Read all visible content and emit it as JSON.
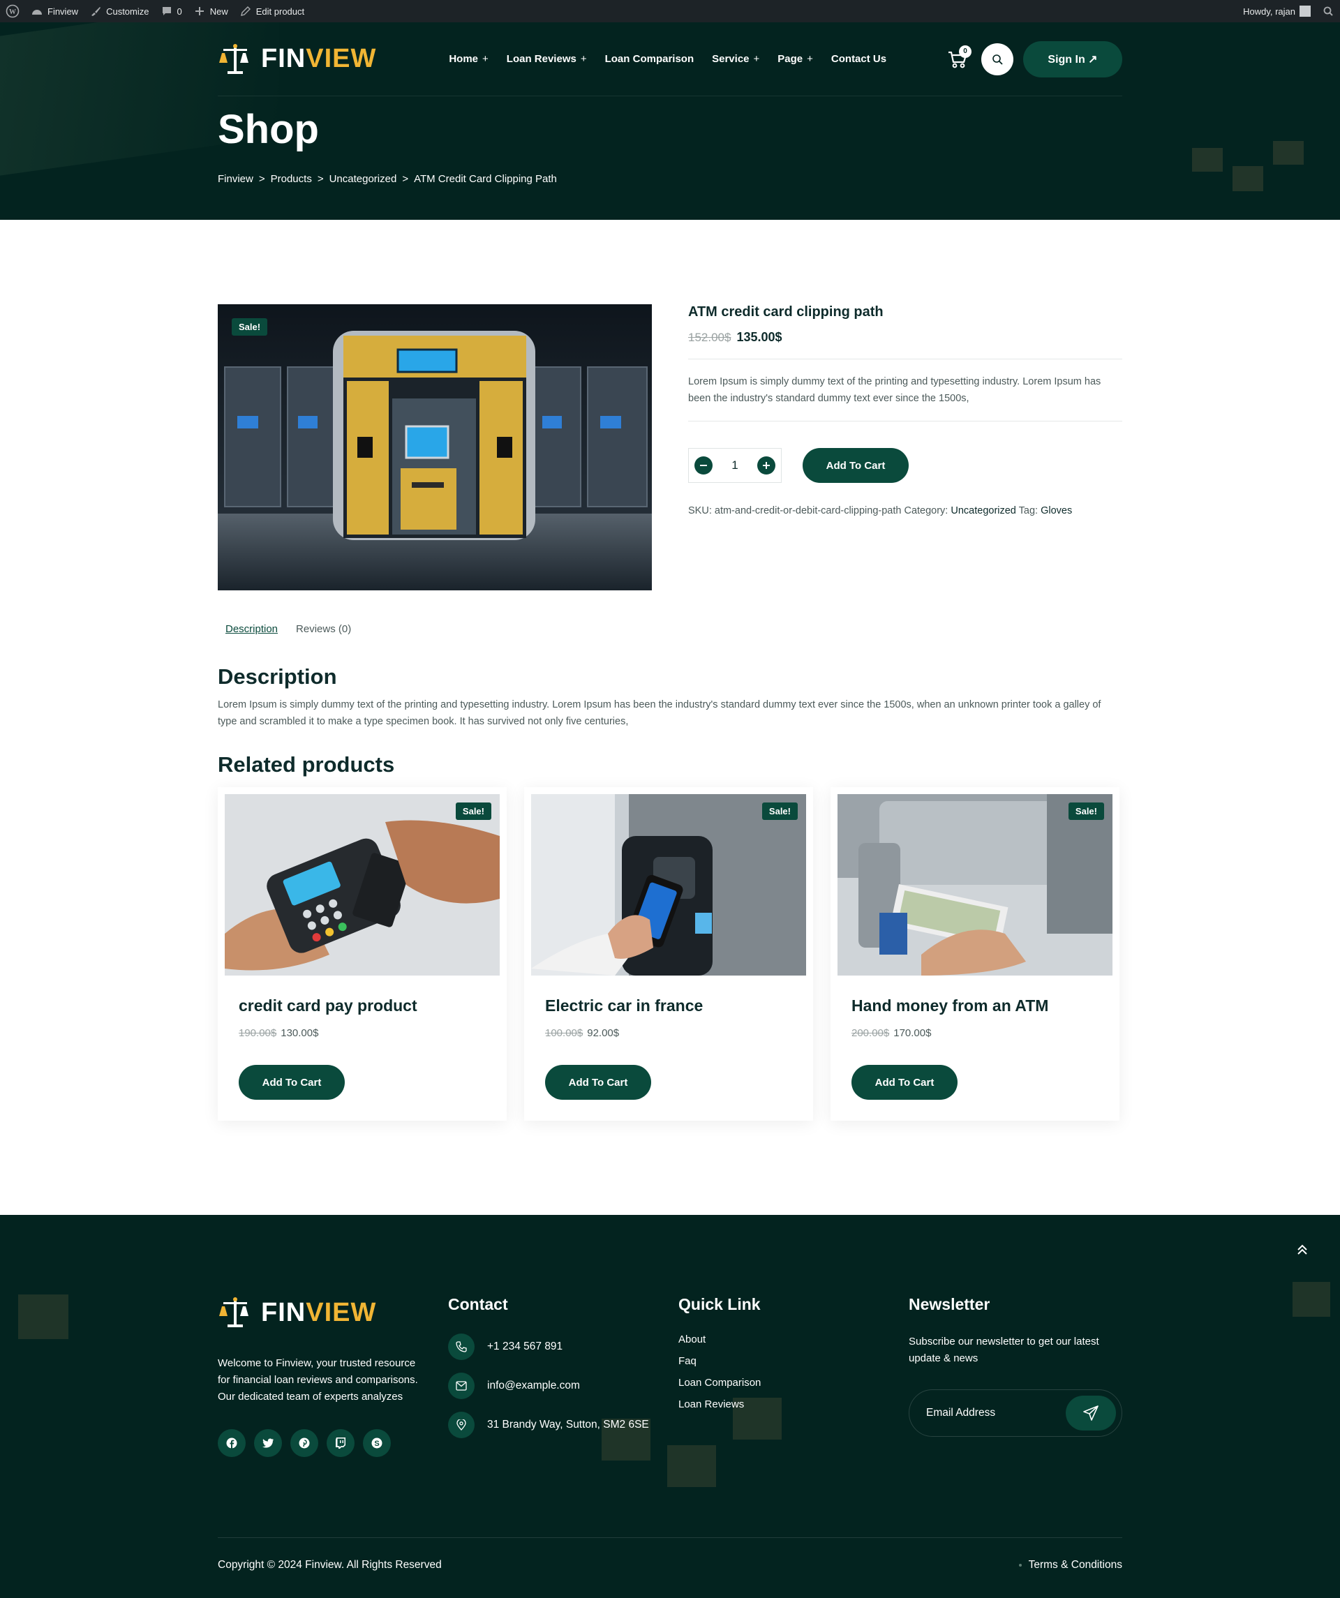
{
  "adminbar": {
    "site": "Finview",
    "customize": "Customize",
    "comments": "0",
    "new": "New",
    "edit": "Edit product",
    "howdy": "Howdy, rajan"
  },
  "header": {
    "logo_part1": "FIN",
    "logo_part2": "VIEW",
    "nav": [
      {
        "label": "Home",
        "plus": "+"
      },
      {
        "label": "Loan Reviews",
        "plus": "+"
      },
      {
        "label": "Loan Comparison",
        "plus": ""
      },
      {
        "label": "Service",
        "plus": "+"
      },
      {
        "label": "Page",
        "plus": "+"
      },
      {
        "label": "Contact Us",
        "plus": ""
      }
    ],
    "cart_count": "0",
    "signin": "Sign In ↗"
  },
  "hero": {
    "title": "Shop",
    "breadcrumb": [
      "Finview",
      ">",
      "Products",
      ">",
      "Uncategorized",
      ">",
      "ATM Credit Card Clipping Path"
    ]
  },
  "product": {
    "sale_badge": "Sale!",
    "title": "ATM credit card clipping path",
    "old_price": "152.00$",
    "new_price": "135.00$",
    "short_desc": "Lorem Ipsum is simply dummy text of the printing and typesetting industry. Lorem Ipsum has been the industry's standard dummy text ever since the 1500s,",
    "qty": "1",
    "add_to_cart": "Add To Cart",
    "sku_label": "SKU:",
    "sku": "atm-and-credit-or-debit-card-clipping-path",
    "category_label": "Category:",
    "category": "Uncategorized",
    "tag_label": "Tag:",
    "tag": "Gloves"
  },
  "tabs": [
    "Description",
    "Reviews (0)"
  ],
  "description": {
    "heading": "Description",
    "text": "Lorem Ipsum is simply dummy text of the printing and typesetting industry. Lorem Ipsum has been the industry's standard dummy text ever since the 1500s, when an unknown printer took a galley of type and scrambled it to make a type specimen book. It has survived not only five centuries,"
  },
  "related": {
    "heading": "Related products",
    "items": [
      {
        "sale": "Sale!",
        "title": "credit card pay product",
        "old": "190.00$",
        "new": "130.00$",
        "button": "Add To Cart"
      },
      {
        "sale": "Sale!",
        "title": "Electric car in france",
        "old": "100.00$",
        "new": "92.00$",
        "button": "Add To Cart"
      },
      {
        "sale": "Sale!",
        "title": "Hand money from an ATM",
        "old": "200.00$",
        "new": "170.00$",
        "button": "Add To Cart"
      }
    ]
  },
  "footer": {
    "logo_part1": "FIN",
    "logo_part2": "VIEW",
    "about": "Welcome to Finview, your trusted resource for financial loan reviews and comparisons. Our dedicated team of experts analyzes",
    "contact_heading": "Contact",
    "phone": "+1 234 567 891",
    "email": "info@example.com",
    "address": "31 Brandy Way, Sutton, SM2 6SE",
    "quick_heading": "Quick Link",
    "quick_links": [
      "About",
      "Faq",
      "Loan Comparison",
      "Loan Reviews"
    ],
    "newsletter_heading": "Newsletter",
    "newsletter_text": "Subscribe our newsletter to get our latest update & news",
    "email_placeholder": "Email Address",
    "copyright": "Copyright © 2024 Finview. All Rights Reserved",
    "terms": "Terms & Conditions"
  },
  "colors": {
    "dark": "#03231f",
    "accent": "#0a4a3c",
    "gold": "#f1b534"
  }
}
